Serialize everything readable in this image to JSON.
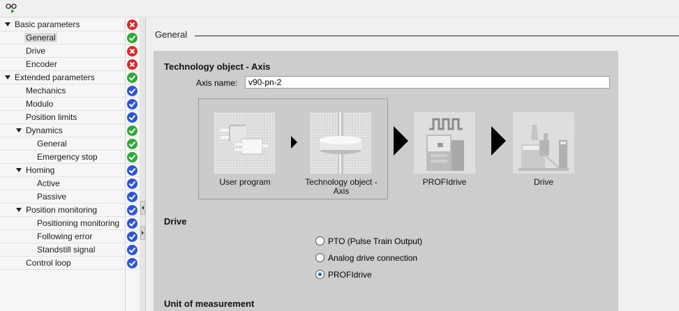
{
  "colors": {
    "error": "#d82828",
    "ok_green": "#2ea838",
    "ok_blue": "#2c55d6",
    "panel_bg": "#cdcdcd"
  },
  "tree": {
    "items": [
      {
        "label": "Basic parameters",
        "level": 0,
        "expanded": true,
        "status": "error"
      },
      {
        "label": "General",
        "level": 1,
        "selected": true,
        "status": "ok_green"
      },
      {
        "label": "Drive",
        "level": 1,
        "status": "error"
      },
      {
        "label": "Encoder",
        "level": 1,
        "status": "error"
      },
      {
        "label": "Extended parameters",
        "level": 0,
        "expanded": true,
        "status": "ok_green"
      },
      {
        "label": "Mechanics",
        "level": 1,
        "status": "ok_blue"
      },
      {
        "label": "Modulo",
        "level": 1,
        "status": "ok_blue"
      },
      {
        "label": "Position limits",
        "level": 1,
        "status": "ok_blue"
      },
      {
        "label": "Dynamics",
        "level": 1,
        "expanded": true,
        "status": "ok_green"
      },
      {
        "label": "General",
        "level": 2,
        "status": "ok_green"
      },
      {
        "label": "Emergency stop",
        "level": 2,
        "status": "ok_green"
      },
      {
        "label": "Homing",
        "level": 1,
        "expanded": true,
        "status": "ok_blue"
      },
      {
        "label": "Active",
        "level": 2,
        "status": "ok_blue"
      },
      {
        "label": "Passive",
        "level": 2,
        "status": "ok_blue"
      },
      {
        "label": "Position monitoring",
        "level": 1,
        "expanded": true,
        "status": "ok_blue"
      },
      {
        "label": "Positioning monitoring",
        "level": 2,
        "status": "ok_blue"
      },
      {
        "label": "Following error",
        "level": 2,
        "status": "ok_blue"
      },
      {
        "label": "Standstill signal",
        "level": 2,
        "status": "ok_blue"
      },
      {
        "label": "Control loop",
        "level": 1,
        "status": "ok_blue"
      }
    ]
  },
  "content": {
    "section_title": "General",
    "technology_object_heading": "Technology object - Axis",
    "axis_name_label": "Axis name:",
    "axis_name_value": "v90-pn-2",
    "chain": {
      "user_program": "User program",
      "technology_object": "Technology object -\nAxis",
      "profidrive": "PROFIdrive",
      "drive": "Drive"
    },
    "drive_heading": "Drive",
    "drive_options": [
      {
        "label": "PTO (Pulse Train Output)",
        "checked": false
      },
      {
        "label": "Analog drive connection",
        "checked": false
      },
      {
        "label": "PROFIdrive",
        "checked": true
      }
    ],
    "unit_heading": "Unit of measurement"
  }
}
